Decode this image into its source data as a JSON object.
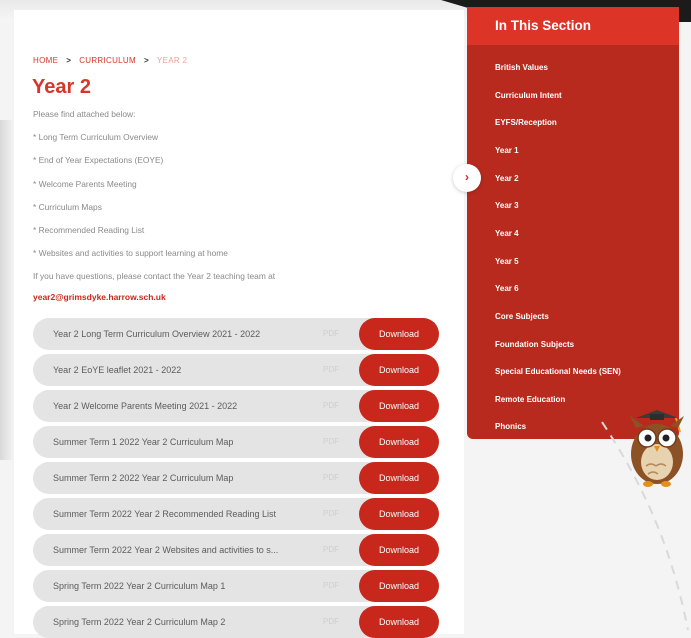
{
  "breadcrumb": {
    "home": "HOME",
    "curriculum": "CURRICULUM",
    "current": "YEAR 2",
    "separator": ">"
  },
  "page_title": "Year 2",
  "intro": [
    "Please find attached below:",
    "* Long Term Curriculum Overview",
    "* End of Year Expectations (EOYE)",
    "* Welcome Parents Meeting",
    "* Curriculum Maps",
    "* Recommended Reading List",
    "* Websites and activities to support learning at home",
    "If you have questions, please contact the Year 2 teaching team at"
  ],
  "email": "year2@grimsdyke.harrow.sch.uk",
  "downloads": [
    {
      "title": "Year 2 Long Term Curriculum Overview 2021 - 2022",
      "type": "PDF",
      "button": "Download"
    },
    {
      "title": "Year 2 EoYE leaflet 2021 - 2022",
      "type": "PDF",
      "button": "Download"
    },
    {
      "title": "Year 2 Welcome Parents Meeting 2021 - 2022",
      "type": "PDF",
      "button": "Download"
    },
    {
      "title": "Summer Term 1 2022 Year 2 Curriculum Map",
      "type": "PDF",
      "button": "Download"
    },
    {
      "title": "Summer Term 2 2022 Year 2 Curriculum Map",
      "type": "PDF",
      "button": "Download"
    },
    {
      "title": "Summer Term 2022 Year 2 Recommended Reading List",
      "type": "PDF",
      "button": "Download"
    },
    {
      "title": "Summer Term 2022 Year 2 Websites and activities to s...",
      "type": "PDF",
      "button": "Download"
    },
    {
      "title": "Spring Term 2022 Year 2 Curriculum Map 1",
      "type": "PDF",
      "button": "Download"
    },
    {
      "title": "Spring Term 2022 Year 2 Curriculum Map 2",
      "type": "PDF",
      "button": "Download"
    }
  ],
  "sidebar": {
    "title": "In This Section",
    "toggle_icon": "chevron-right-icon",
    "items": [
      "British Values",
      "Curriculum Intent",
      "EYFS/Reception",
      "Year 1",
      "Year 2",
      "Year 3",
      "Year 4",
      "Year 5",
      "Year 6",
      "Core Subjects",
      "Foundation Subjects",
      "Special Educational Needs (SEN)",
      "Remote Education",
      "Phonics"
    ]
  },
  "colors": {
    "accent": "#c8271c",
    "sidebar_bg": "#b82a1e",
    "sidebar_head": "#dc3427",
    "row_bg": "#e4e4e4"
  }
}
